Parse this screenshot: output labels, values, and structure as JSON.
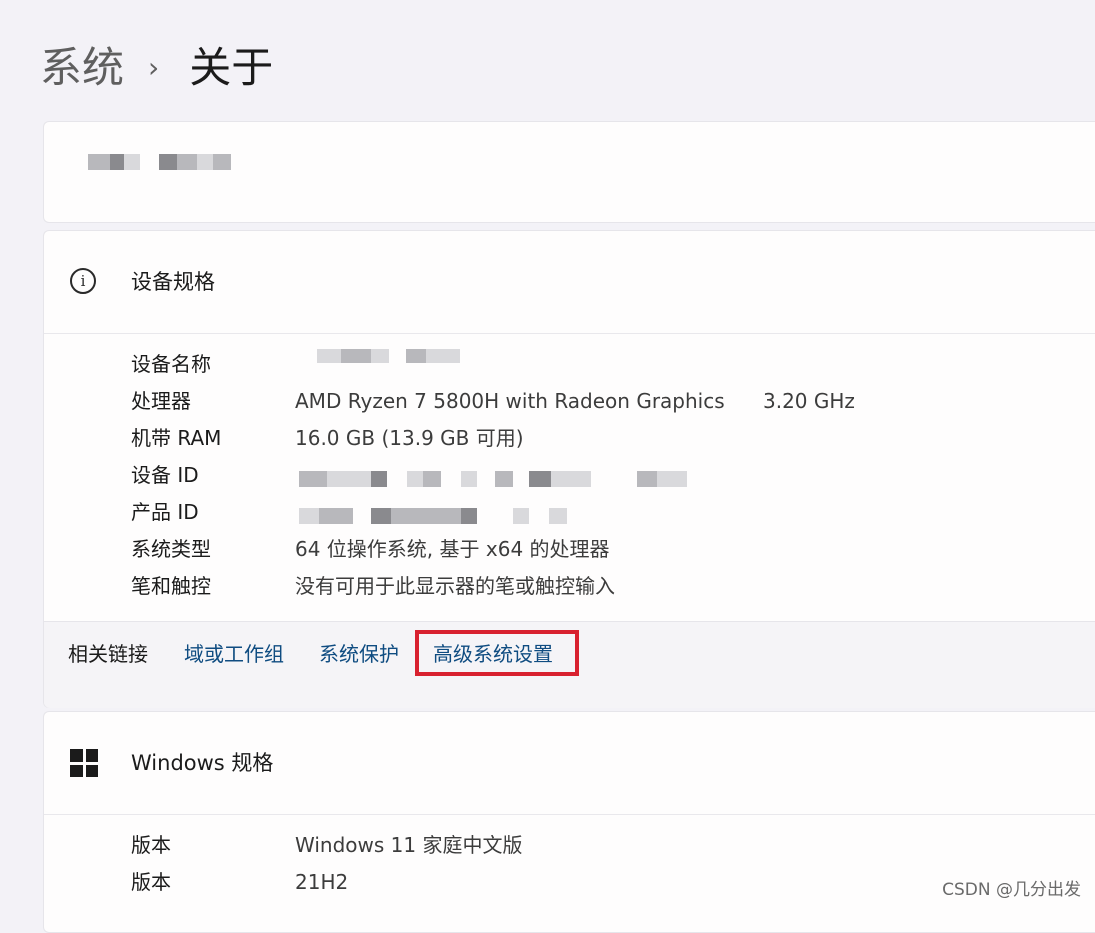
{
  "breadcrumb": {
    "parent": "系统",
    "separator": "›",
    "current": "关于"
  },
  "device_specs": {
    "title": "设备规格",
    "icon": "info-icon",
    "rows": [
      {
        "label": "设备名称",
        "value": ""
      },
      {
        "label": "处理器",
        "value": "AMD Ryzen 7 5800H with Radeon Graphics",
        "extra": "3.20 GHz"
      },
      {
        "label": "机带 RAM",
        "value": "16.0 GB (13.9 GB 可用)"
      },
      {
        "label": "设备 ID",
        "value": ""
      },
      {
        "label": "产品 ID",
        "value": ""
      },
      {
        "label": "系统类型",
        "value": "64 位操作系统, 基于 x64 的处理器"
      },
      {
        "label": "笔和触控",
        "value": "没有可用于此显示器的笔或触控输入"
      }
    ]
  },
  "related_links": {
    "label": "相关链接",
    "links": [
      "域或工作组",
      "系统保护",
      "高级系统设置"
    ]
  },
  "windows_specs": {
    "title": "Windows 规格",
    "icon": "windows-logo-icon",
    "rows": [
      {
        "label": "版本",
        "value": "Windows 11 家庭中文版"
      },
      {
        "label": "版本",
        "value": "21H2"
      }
    ]
  },
  "watermark": "CSDN @几分出发",
  "colors": {
    "link": "#0f4c81",
    "highlight": "#d8212f"
  }
}
